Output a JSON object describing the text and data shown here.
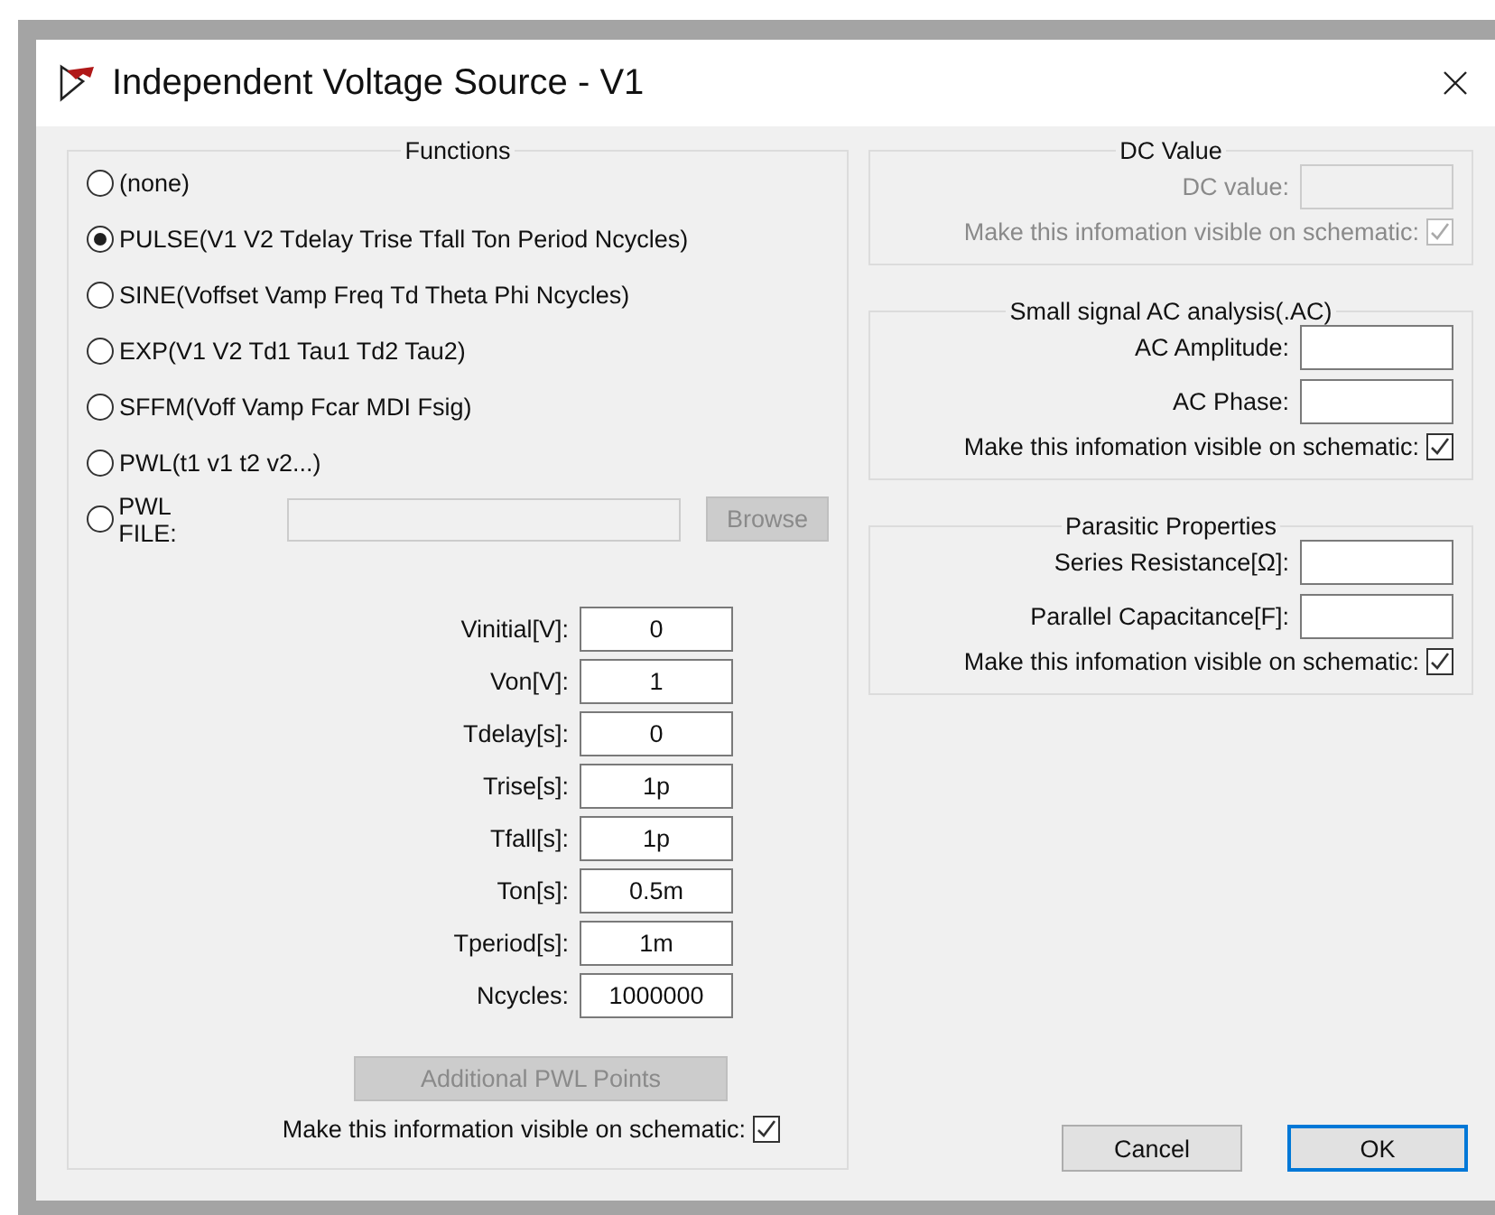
{
  "window": {
    "title": "Independent Voltage Source - V1"
  },
  "functions": {
    "title": "Functions",
    "options": [
      {
        "kind": "plain",
        "label": "(none)",
        "selected": false
      },
      {
        "kind": "plain",
        "label": "PULSE(V1 V2 Tdelay Trise Tfall Ton Period Ncycles)",
        "selected": true
      },
      {
        "kind": "plain",
        "label": "SINE(Voffset Vamp Freq Td Theta Phi Ncycles)",
        "selected": false
      },
      {
        "kind": "plain",
        "label": "EXP(V1 V2 Td1 Tau1 Td2 Tau2)",
        "selected": false
      },
      {
        "kind": "plain",
        "label": "SFFM(Voff Vamp Fcar MDI Fsig)",
        "selected": false
      },
      {
        "kind": "plain",
        "label": "PWL(t1 v1 t2 v2...)",
        "selected": false
      },
      {
        "kind": "file",
        "label": "PWL FILE:",
        "selected": false,
        "button": {
          "label": "Browse",
          "disabled": true
        }
      }
    ],
    "params": [
      {
        "label": "Vinitial[V]:",
        "value": "0"
      },
      {
        "label": "Von[V]:",
        "value": "1"
      },
      {
        "label": "Tdelay[s]:",
        "value": "0"
      },
      {
        "label": "Trise[s]:",
        "value": "1p"
      },
      {
        "label": "Tfall[s]:",
        "value": "1p"
      },
      {
        "label": "Ton[s]:",
        "value": "0.5m"
      },
      {
        "label": "Tperiod[s]:",
        "value": "1m"
      },
      {
        "label": "Ncycles:",
        "value": "1000000"
      }
    ],
    "additional_button": {
      "label": "Additional PWL Points",
      "disabled": true
    },
    "visible": {
      "label": "Make this information visible on schematic:",
      "checked": true,
      "disabled": false
    }
  },
  "groups": [
    {
      "title": "DC Value",
      "fields": [
        {
          "label": "DC value:",
          "disabled": true
        }
      ],
      "visible": {
        "label": "Make this infomation visible on schematic:",
        "checked": true,
        "disabled": true
      }
    },
    {
      "title": "Small signal AC analysis(.AC)",
      "fields": [
        {
          "label": "AC Amplitude:",
          "disabled": false
        },
        {
          "label": "AC Phase:",
          "disabled": false
        }
      ],
      "visible": {
        "label": "Make this infomation visible on schematic:",
        "checked": true,
        "disabled": false
      }
    },
    {
      "title": "Parasitic Properties",
      "fields": [
        {
          "label": "Series Resistance[Ω]:",
          "disabled": false
        },
        {
          "label": "Parallel Capacitance[F]:",
          "disabled": false
        }
      ],
      "visible": {
        "label": "Make this infomation visible on schematic:",
        "checked": true,
        "disabled": false
      }
    }
  ],
  "buttons": [
    {
      "label": "Cancel",
      "default": false
    },
    {
      "label": "OK",
      "default": true
    }
  ]
}
